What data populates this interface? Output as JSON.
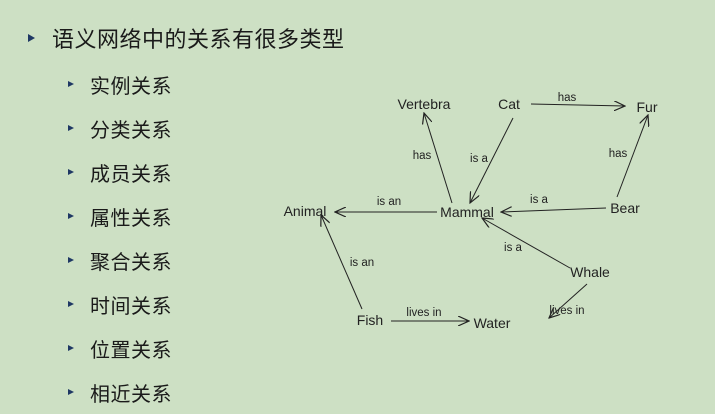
{
  "slide": {
    "title": "语义网络中的关系有很多类型",
    "relations": [
      "实例关系",
      "分类关系",
      "成员关系",
      "属性关系",
      "聚合关系",
      "时间关系",
      "位置关系",
      "相近关系"
    ]
  },
  "network": {
    "nodes": [
      {
        "id": "vertebra",
        "label": "Vertebra"
      },
      {
        "id": "cat",
        "label": "Cat"
      },
      {
        "id": "fur",
        "label": "Fur"
      },
      {
        "id": "animal",
        "label": "Animal"
      },
      {
        "id": "mammal",
        "label": "Mammal"
      },
      {
        "id": "bear",
        "label": "Bear"
      },
      {
        "id": "whale",
        "label": "Whale"
      },
      {
        "id": "fish",
        "label": "Fish"
      },
      {
        "id": "water",
        "label": "Water"
      }
    ],
    "edges": [
      {
        "from": "cat",
        "to": "fur",
        "label": "has"
      },
      {
        "from": "mammal",
        "to": "vertebra",
        "label": "has"
      },
      {
        "from": "cat",
        "to": "mammal",
        "label": "is a"
      },
      {
        "from": "mammal",
        "to": "animal",
        "label": "is an"
      },
      {
        "from": "bear",
        "to": "mammal",
        "label": "is a"
      },
      {
        "from": "bear",
        "to": "fur",
        "label": "has"
      },
      {
        "from": "whale",
        "to": "mammal",
        "label": "is a"
      },
      {
        "from": "fish",
        "to": "animal",
        "label": "is an"
      },
      {
        "from": "fish",
        "to": "water",
        "label": "lives in"
      },
      {
        "from": "whale",
        "to": "water",
        "label": "lives in"
      }
    ]
  },
  "colors": {
    "background": "#cde0c4",
    "bullet": "#1f3864",
    "text": "#1a1a1a"
  }
}
